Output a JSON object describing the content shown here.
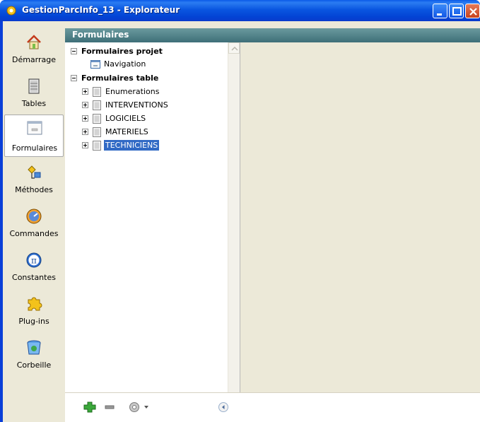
{
  "window": {
    "title": "GestionParcInfo_13 - Explorateur"
  },
  "sidebar": {
    "items": [
      {
        "label": "Démarrage",
        "icon": "house-icon"
      },
      {
        "label": "Tables",
        "icon": "table-icon"
      },
      {
        "label": "Formulaires",
        "icon": "form-icon",
        "selected": true
      },
      {
        "label": "Méthodes",
        "icon": "method-icon"
      },
      {
        "label": "Commandes",
        "icon": "command-icon"
      },
      {
        "label": "Constantes",
        "icon": "pi-icon"
      },
      {
        "label": "Plug-ins",
        "icon": "puzzle-icon"
      },
      {
        "label": "Corbeille",
        "icon": "trash-icon"
      }
    ]
  },
  "panel": {
    "header": "Formulaires"
  },
  "tree": {
    "project_group": "Formulaires projet",
    "project_items": [
      "Navigation"
    ],
    "table_group": "Formulaires table",
    "table_items": [
      "Enumerations",
      "INTERVENTIONS",
      "LOGICIELS",
      "MATERIELS",
      "TECHNICIENS"
    ],
    "selected_item": "TECHNICIENS"
  },
  "toolbar": {
    "icons": [
      "add-icon",
      "remove-icon",
      "gear-menu-icon",
      "collapse-icon"
    ]
  },
  "colors": {
    "titlebar": "#0a56e0",
    "header": "#4a7c84",
    "selection": "#316ac5",
    "background": "#ece9d8"
  }
}
